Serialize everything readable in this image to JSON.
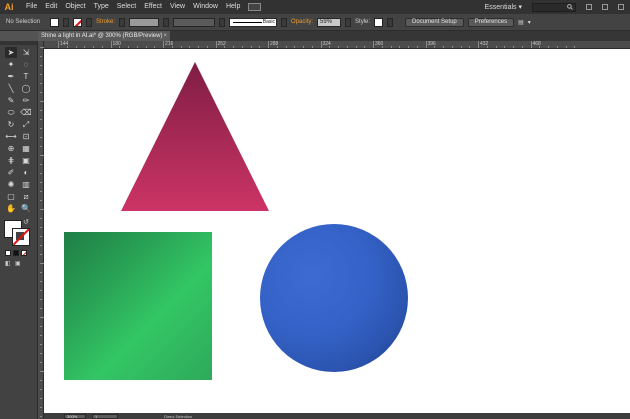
{
  "app": {
    "logo": "Ai"
  },
  "menubar": {
    "items": [
      "File",
      "Edit",
      "Object",
      "Type",
      "Select",
      "Effect",
      "View",
      "Window",
      "Help"
    ],
    "workspace": "Essentials",
    "workspace_arrow": "▾"
  },
  "controlbar": {
    "selection_label": "No Selection",
    "stroke_label": "Stroke:",
    "stroke_profile": "Basic",
    "opacity_label": "Opacity:",
    "opacity_value": "59%",
    "style_label": "Style:",
    "document_setup_label": "Document Setup",
    "preferences_label": "Preferences"
  },
  "document": {
    "tab_title": "Shine a light in AI.ai* @ 300% (RGB/Preview)",
    "close_glyph": "×"
  },
  "ruler": {
    "top_labels": [
      "144",
      "180",
      "216",
      "252",
      "288",
      "324",
      "360",
      "396",
      "432",
      "468"
    ]
  },
  "status": {
    "zoom": "300%",
    "artboard": "1",
    "mode": "Direct Selection"
  },
  "colors": {
    "triangle_top": "#7e1d43",
    "triangle_bottom": "#cc3465",
    "square": "#2ea95a",
    "circle": "#3461c6",
    "accent": "#f29b2b"
  },
  "icons": {
    "tools": [
      "selection-tool-icon",
      "direct-selection-tool-icon",
      "magic-wand-tool-icon",
      "lasso-tool-icon",
      "pen-tool-icon",
      "type-tool-icon",
      "line-segment-tool-icon",
      "ellipse-tool-icon",
      "paintbrush-tool-icon",
      "pencil-tool-icon",
      "blob-brush-tool-icon",
      "eraser-tool-icon",
      "rotate-tool-icon",
      "scale-tool-icon",
      "width-tool-icon",
      "free-transform-tool-icon",
      "shape-builder-tool-icon",
      "perspective-grid-tool-icon",
      "mesh-tool-icon",
      "gradient-tool-icon",
      "eyedropper-tool-icon",
      "blend-tool-icon",
      "symbol-sprayer-tool-icon",
      "column-graph-tool-icon",
      "artboard-tool-icon",
      "slice-tool-icon",
      "hand-tool-icon",
      "zoom-tool-icon"
    ]
  }
}
